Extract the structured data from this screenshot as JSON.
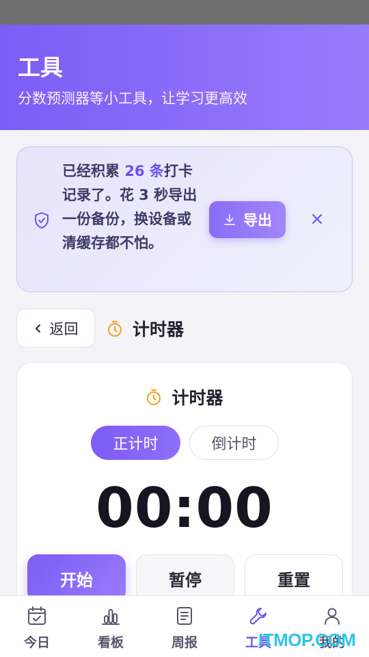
{
  "header": {
    "title": "工具",
    "subtitle": "分数预测器等小工具，让学习更高效"
  },
  "notice": {
    "text_prefix": "已经积累 ",
    "count": "26 条",
    "text_mid": "打卡记录了。花 3 秒导出一份备份，换设备或清缓存都不怕。",
    "export_label": "导出",
    "shield_icon": "shield-check-icon",
    "download_icon": "download-icon",
    "close_icon": "close-icon"
  },
  "nav": {
    "back_label": "返回",
    "section_title": "计时器"
  },
  "timer": {
    "title": "计时器",
    "modes": [
      "正计时",
      "倒计时"
    ],
    "active_mode": "正计时",
    "display": "00:00",
    "start_label": "开始",
    "pause_label": "暂停",
    "reset_label": "重置"
  },
  "tabs": [
    {
      "label": "今日",
      "icon": "calendar-check-icon"
    },
    {
      "label": "看板",
      "icon": "bar-chart-icon"
    },
    {
      "label": "周报",
      "icon": "document-icon"
    },
    {
      "label": "工具",
      "icon": "wrench-icon",
      "active": true
    },
    {
      "label": "我的",
      "icon": "user-icon"
    }
  ],
  "watermark": "ITMOP.COM",
  "colors": {
    "accent": "#7c5cf5",
    "timer_icon": "#f0a020",
    "watermark": "#2ec4e6"
  }
}
